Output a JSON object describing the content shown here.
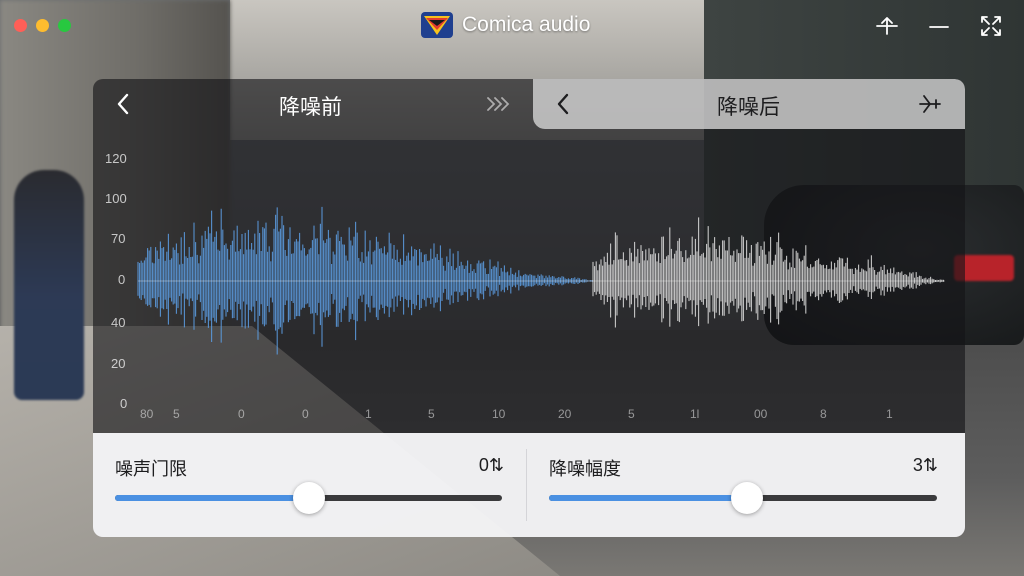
{
  "window": {
    "title": "Comica audio",
    "logo_icon": "comica-logo-icon",
    "controls": [
      "pin-icon",
      "minimize-icon",
      "fullscreen-icon"
    ]
  },
  "tabs": {
    "before": {
      "title": "降噪前",
      "back_icon": "chevron-left-icon",
      "action_icon": "fast-forward-icon"
    },
    "after": {
      "title": "降噪后",
      "back_icon": "chevron-left-icon",
      "action_icon": "airplane-icon"
    }
  },
  "waveform": {
    "y_labels": [
      "120",
      "100",
      "70",
      "0",
      "40",
      "20",
      "0"
    ],
    "x_labels": [
      "80",
      "5",
      "0",
      "0",
      "1",
      "5",
      "10",
      "20",
      "5",
      "1l",
      "00",
      "8",
      "1"
    ],
    "colors": {
      "before": "#5b9bdf",
      "after": "#d8d8d8"
    }
  },
  "controls": {
    "threshold": {
      "label": "噪声门限",
      "value_text": "0⇅",
      "level_percent": 50,
      "fill_color": "#4a90e2"
    },
    "amount": {
      "label": "降噪幅度",
      "value_text": "3⇅",
      "level_percent": 51,
      "fill_color": "#4a90e2"
    }
  }
}
